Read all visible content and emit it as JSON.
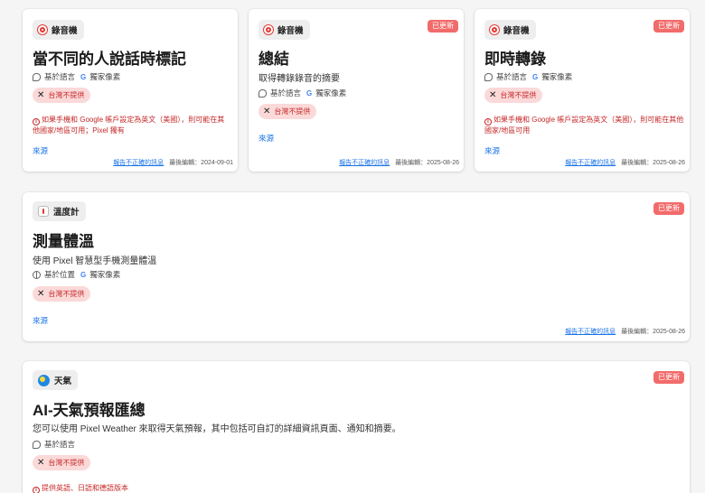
{
  "cards": [
    {
      "app": "錄音機",
      "title": "當不同的人說話時標記",
      "meta1": "基於語言",
      "meta2": "獨家像素",
      "unavailable": "台灣不提供",
      "warning": "如果手機和 Google 帳戶設定為英文（美國），則可能在其他國家/地區可用；Pixel 獨有",
      "source": "來源",
      "report": "報告不正確的訊息",
      "edited": "最後編輯：2024-09-01"
    },
    {
      "app": "錄音機",
      "badge": "已更新",
      "title": "總結",
      "desc": "取得轉錄錄音的摘要",
      "meta1": "基於語言",
      "meta2": "獨家像素",
      "unavailable": "台灣不提供",
      "source": "來源",
      "report": "報告不正確的訊息",
      "edited": "最後編輯：2025-08-26"
    },
    {
      "app": "錄音機",
      "badge": "已更新",
      "title": "即時轉錄",
      "meta1": "基於語言",
      "meta2": "獨家像素",
      "unavailable": "台灣不提供",
      "warning": "如果手機和 Google 帳戶設定為英文（美國），則可能在其他國家/地區可用",
      "source": "來源",
      "report": "報告不正確的訊息",
      "edited": "最後編輯：2025-08-26"
    },
    {
      "app": "溫度計",
      "badge": "已更新",
      "title": "測量體溫",
      "desc": "使用 Pixel 智慧型手機測量體溫",
      "meta1": "基於位置",
      "meta2": "獨家像素",
      "unavailable": "台灣不提供",
      "source": "來源",
      "report": "報告不正確的訊息",
      "edited": "最後編輯：2025-08-26"
    },
    {
      "app": "天氣",
      "badge": "已更新",
      "title": "AI-天氣預報匯總",
      "desc": "您可以使用 Pixel Weather 來取得天氣預報，其中包括可自訂的詳細資訊頁面、通知和摘要。",
      "meta1": "基於語言",
      "unavailable": "台灣不提供",
      "warning": "提供英語、日語和德語版本"
    }
  ],
  "icons": {
    "recorder": "recorder-app-icon",
    "thermometer": "thermometer-app-icon",
    "weather": "weather-app-icon",
    "chat": "chat-icon",
    "globe": "globe-icon",
    "google": "google-g-icon",
    "close": "close-icon",
    "info": "info-icon"
  },
  "colors": {
    "badge": "#f26b6b",
    "pill_bg": "#fbd9d9",
    "warning": "#c62828",
    "link": "#1a73e8"
  }
}
